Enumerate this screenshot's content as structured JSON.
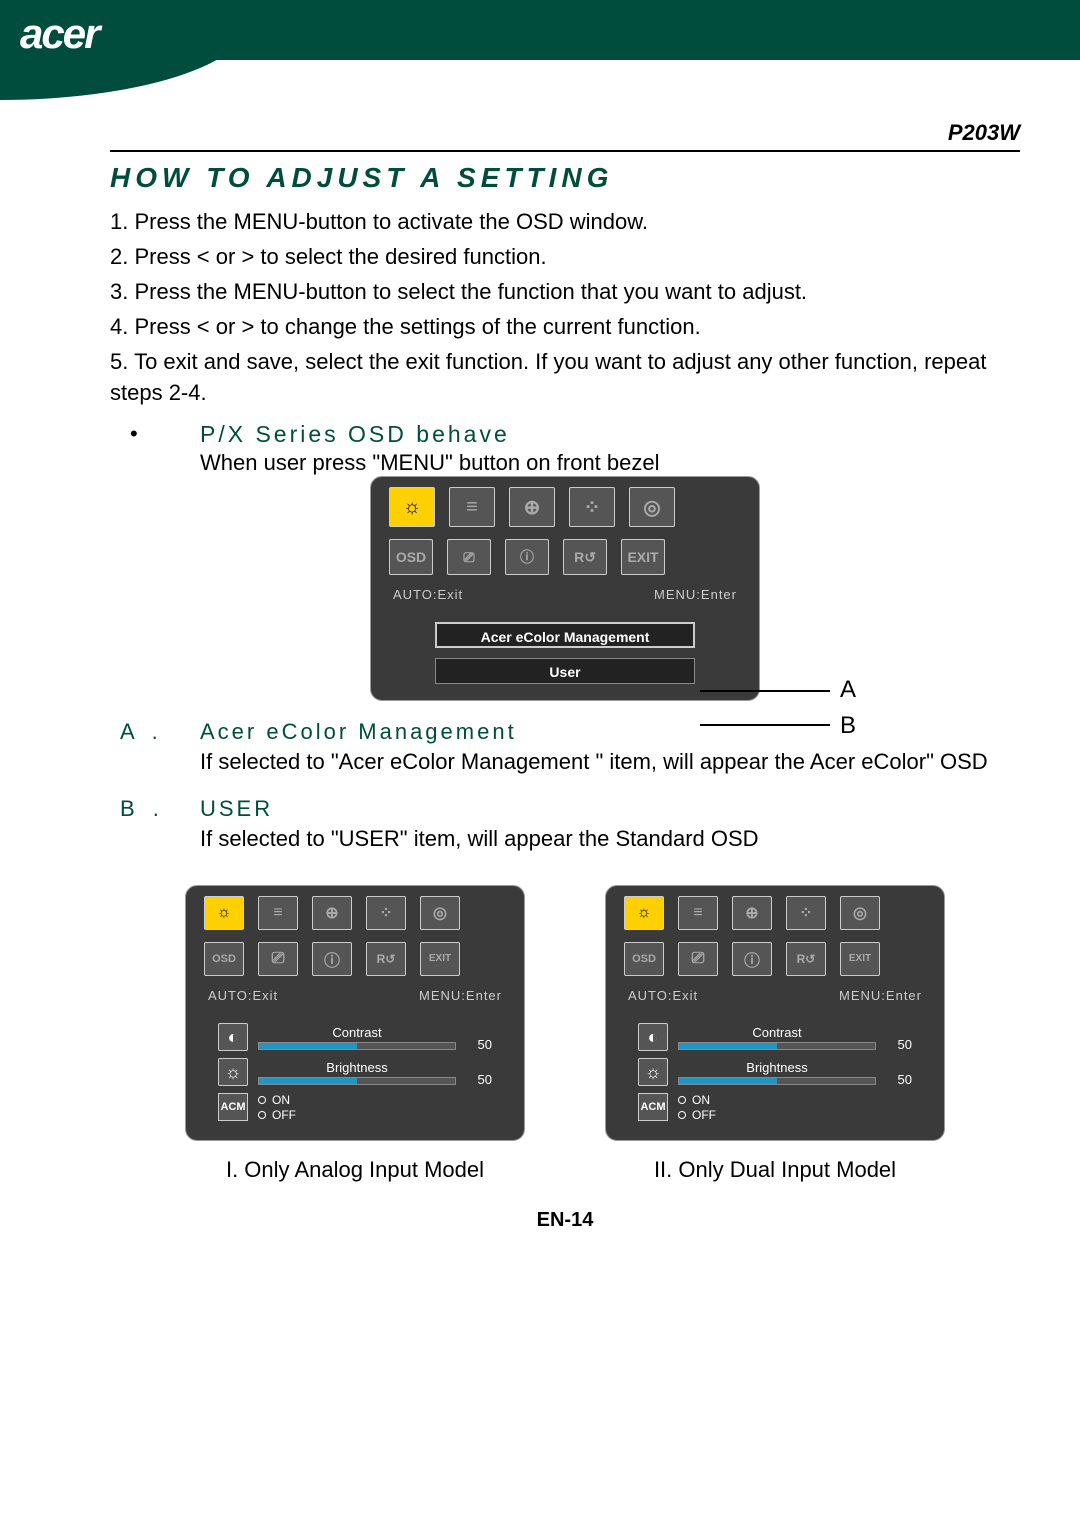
{
  "brand": "acer",
  "model": "P203W",
  "title": "HOW TO ADJUST A SETTING",
  "steps": [
    "1. Press the MENU-button  to activate the OSD window.",
    "2. Press < or  > to select the desired function.",
    "3. Press the MENU-button  to select the function that you want to adjust.",
    "4. Press < or  > to change the settings of the current function.",
    "5. To exit and save, select the exit function. If you want to adjust any other function, repeat steps 2-4."
  ],
  "behave": {
    "title": "P/X Series OSD behave",
    "desc": "When user press \"MENU\" button on front bezel"
  },
  "osd_hints": {
    "left": "AUTO:Exit",
    "right": "MENU:Enter"
  },
  "osd_buttons": {
    "a": "Acer eColor Management",
    "b": "User"
  },
  "callouts": {
    "a": "A",
    "b": "B"
  },
  "subsections": {
    "a": {
      "label": "A .",
      "title": "Acer eColor Management",
      "desc": "If selected to \"Acer eColor Management \" item, will appear the Acer eColor\" OSD"
    },
    "b": {
      "label": "B .",
      "title": "USER",
      "desc": "If selected to \"USER\" item, will appear the Standard OSD"
    }
  },
  "sliders": {
    "contrast": {
      "label": "Contrast",
      "value": "50"
    },
    "brightness": {
      "label": "Brightness",
      "value": "50"
    },
    "acm": {
      "label": "ACM",
      "on": "ON",
      "off": "OFF"
    }
  },
  "icon_text": {
    "osd": "OSD",
    "exit": "EXIT",
    "reset": "R↺"
  },
  "dual_captions": {
    "left": "I. Only Analog Input Model",
    "right": "II. Only Dual Input Model"
  },
  "page": "EN-14"
}
